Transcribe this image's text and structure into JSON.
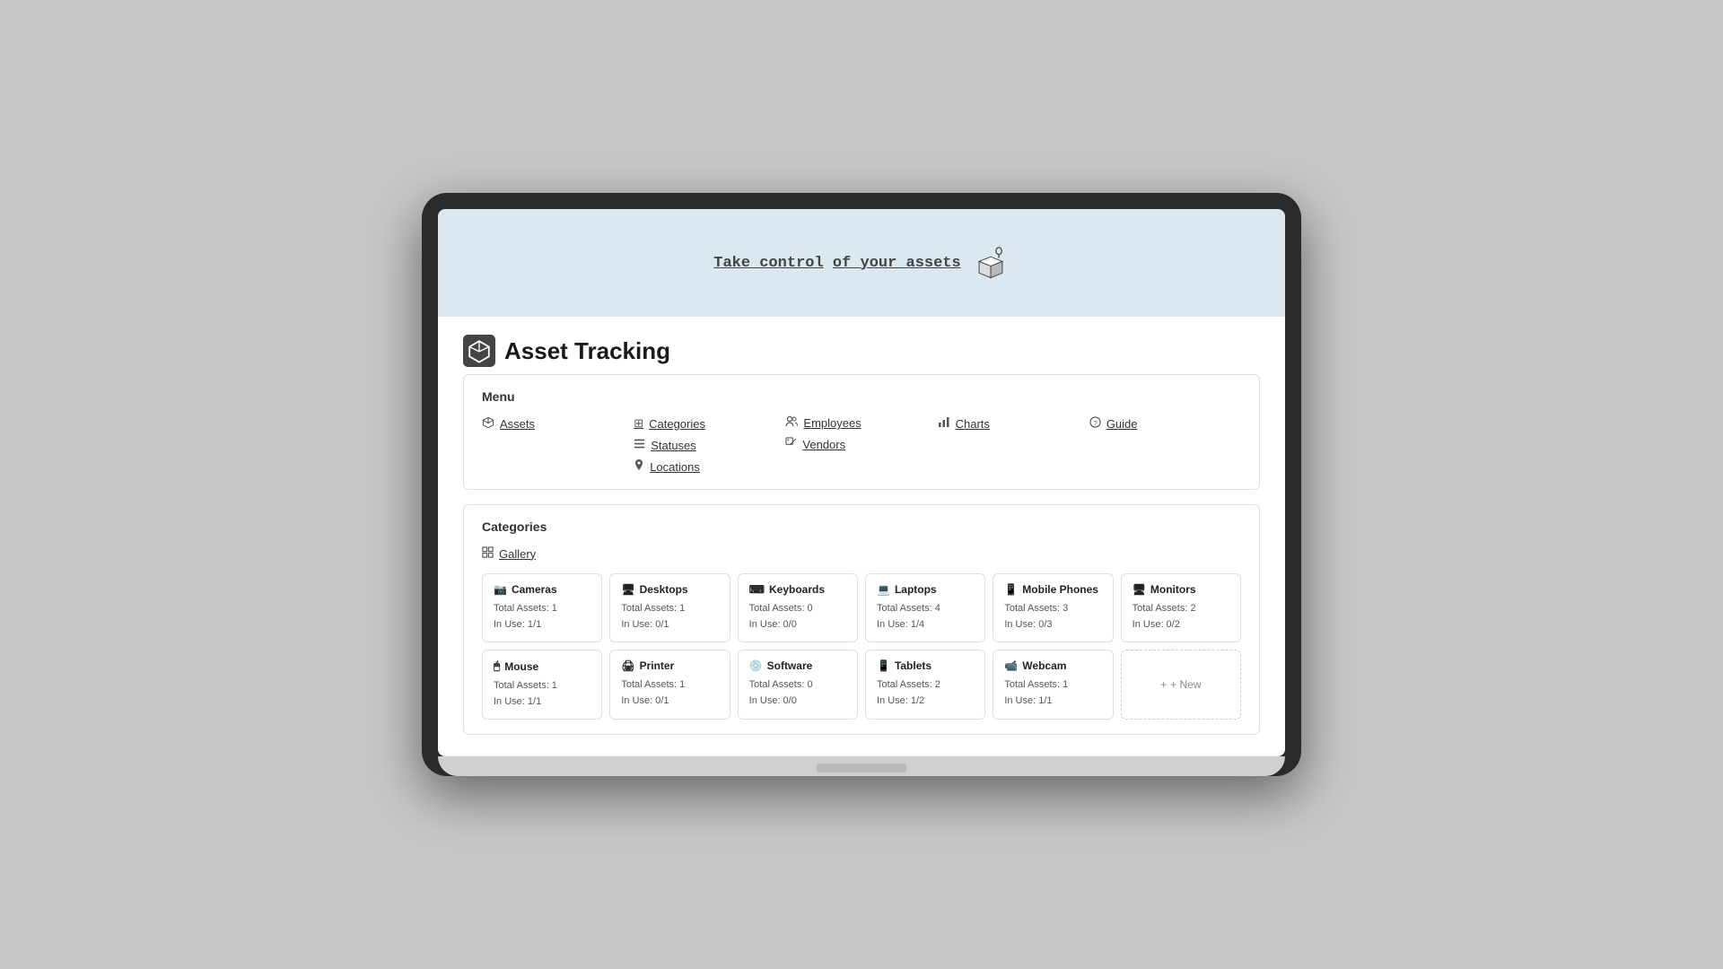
{
  "hero": {
    "text_prefix": "of your assets",
    "text_underline": "Take control",
    "icon_alt": "box-with-pin-icon"
  },
  "app": {
    "title": "Asset Tracking",
    "logo_alt": "asset-tracking-logo"
  },
  "menu": {
    "section_title": "Menu",
    "columns": [
      {
        "items": [
          {
            "label": "Assets",
            "icon": "box-icon"
          }
        ]
      },
      {
        "items": [
          {
            "label": "Categories",
            "icon": "grid-icon"
          },
          {
            "label": "Statuses",
            "icon": "list-icon"
          },
          {
            "label": "Locations",
            "icon": "pin-icon"
          }
        ]
      },
      {
        "items": [
          {
            "label": "Employees",
            "icon": "people-icon"
          },
          {
            "label": "Vendors",
            "icon": "tag-icon"
          }
        ]
      },
      {
        "items": [
          {
            "label": "Charts",
            "icon": "chart-icon"
          }
        ]
      },
      {
        "items": [
          {
            "label": "Guide",
            "icon": "help-icon"
          }
        ]
      }
    ]
  },
  "categories": {
    "section_title": "Categories",
    "gallery_label": "Gallery",
    "cards": [
      {
        "name": "Cameras",
        "icon": "camera-icon",
        "total_assets": "Total Assets: 1",
        "in_use": "In Use: 1/1"
      },
      {
        "name": "Desktops",
        "icon": "desktop-icon",
        "total_assets": "Total Assets: 1",
        "in_use": "In Use: 0/1"
      },
      {
        "name": "Keyboards",
        "icon": "keyboard-icon",
        "total_assets": "Total Assets: 0",
        "in_use": "In Use: 0/0"
      },
      {
        "name": "Laptops",
        "icon": "laptop-icon",
        "total_assets": "Total Assets: 4",
        "in_use": "In Use: 1/4"
      },
      {
        "name": "Mobile Phones",
        "icon": "phone-icon",
        "total_assets": "Total Assets: 3",
        "in_use": "In Use: 0/3"
      },
      {
        "name": "Monitors",
        "icon": "monitor-icon",
        "total_assets": "Total Assets: 2",
        "in_use": "In Use: 0/2"
      },
      {
        "name": "Mouse",
        "icon": "mouse-icon",
        "total_assets": "Total Assets: 1",
        "in_use": "In Use: 1/1"
      },
      {
        "name": "Printer",
        "icon": "printer-icon",
        "total_assets": "Total Assets: 1",
        "in_use": "In Use: 0/1"
      },
      {
        "name": "Software",
        "icon": "software-icon",
        "total_assets": "Total Assets: 0",
        "in_use": "In Use: 0/0"
      },
      {
        "name": "Tablets",
        "icon": "tablet-icon",
        "total_assets": "Total Assets: 2",
        "in_use": "In Use: 1/2"
      },
      {
        "name": "Webcam",
        "icon": "webcam-icon",
        "total_assets": "Total Assets: 1",
        "in_use": "In Use: 1/1"
      }
    ],
    "new_button": "+ New"
  },
  "icons": {
    "box": "📦",
    "grid": "⊞",
    "list": "≡",
    "pin": "📍",
    "people": "👥",
    "tag": "🏷",
    "chart": "📊",
    "help": "❓",
    "gallery": "⊞",
    "camera": "📷",
    "desktop": "🖥",
    "keyboard": "⌨",
    "laptop": "💻",
    "phone": "📱",
    "monitor": "🖥",
    "mouse": "🖱",
    "printer": "🖨",
    "software": "💿",
    "tablet": "📱",
    "webcam": "📹"
  }
}
